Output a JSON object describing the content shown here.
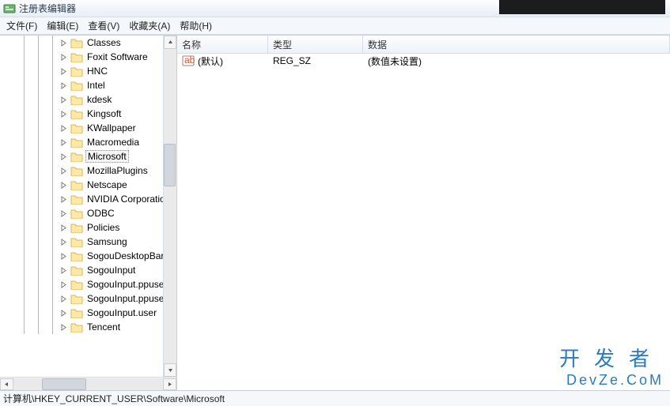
{
  "window": {
    "title": "注册表编辑器"
  },
  "menu": {
    "file": "文件(F)",
    "edit": "编辑(E)",
    "view": "查看(V)",
    "fav": "收藏夹(A)",
    "help": "帮助(H)"
  },
  "tree": {
    "items": [
      {
        "label": "Classes"
      },
      {
        "label": "Foxit Software"
      },
      {
        "label": "HNC"
      },
      {
        "label": "Intel"
      },
      {
        "label": "kdesk"
      },
      {
        "label": "Kingsoft"
      },
      {
        "label": "KWallpaper"
      },
      {
        "label": "Macromedia"
      },
      {
        "label": "Microsoft",
        "selected": true
      },
      {
        "label": "MozillaPlugins"
      },
      {
        "label": "Netscape"
      },
      {
        "label": "NVIDIA Corporation"
      },
      {
        "label": "ODBC"
      },
      {
        "label": "Policies"
      },
      {
        "label": "Samsung"
      },
      {
        "label": "SogouDesktopBar"
      },
      {
        "label": "SogouInput"
      },
      {
        "label": "SogouInput.ppuser"
      },
      {
        "label": "SogouInput.ppuser"
      },
      {
        "label": "SogouInput.user"
      },
      {
        "label": "Tencent"
      }
    ]
  },
  "list": {
    "columns": {
      "name": "名称",
      "type": "类型",
      "data": "数据"
    },
    "rows": [
      {
        "name": "(默认)",
        "type": "REG_SZ",
        "data": "(数值未设置)"
      }
    ]
  },
  "status": {
    "path": "计算机\\HKEY_CURRENT_USER\\Software\\Microsoft"
  },
  "watermark": {
    "line1": "开发者",
    "line2": "DevZe.CoM"
  }
}
